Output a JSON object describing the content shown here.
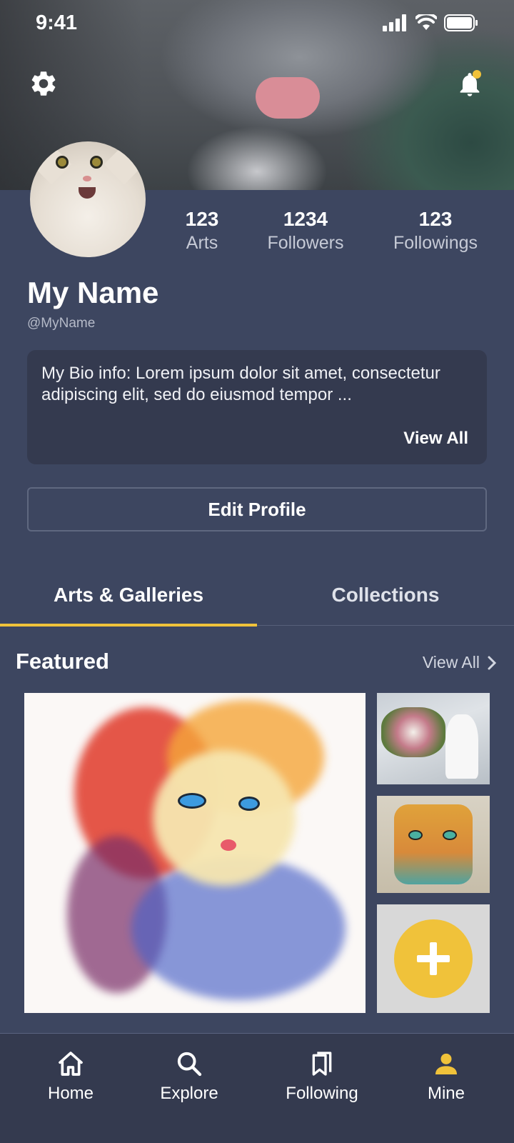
{
  "status_bar": {
    "time": "9:41"
  },
  "header": {
    "settings_icon": "gear-icon",
    "notification_icon": "bell-icon",
    "notification_badge_color": "#f0c23a"
  },
  "profile": {
    "name": "My Name",
    "handle": "@MyName",
    "stats": [
      {
        "value": "123",
        "label": "Arts"
      },
      {
        "value": "1234",
        "label": "Followers"
      },
      {
        "value": "123",
        "label": "Followings"
      }
    ],
    "bio": "My Bio info: Lorem ipsum dolor sit amet, consectetur adipiscing elit, sed do eiusmod tempor ...",
    "bio_view_all": "View All",
    "edit_button": "Edit Profile"
  },
  "tabs": [
    {
      "label": "Arts & Galleries",
      "active": true
    },
    {
      "label": "Collections",
      "active": false
    }
  ],
  "featured": {
    "title": "Featured",
    "view_all": "View All"
  },
  "bottom_nav": [
    {
      "label": "Home",
      "icon": "home-icon",
      "active": false
    },
    {
      "label": "Explore",
      "icon": "search-icon",
      "active": false
    },
    {
      "label": "Following",
      "icon": "bookmarks-icon",
      "active": false
    },
    {
      "label": "Mine",
      "icon": "person-icon",
      "active": true
    }
  ],
  "colors": {
    "background": "#3d4660",
    "card": "#343a4f",
    "accent": "#f0c23a"
  }
}
